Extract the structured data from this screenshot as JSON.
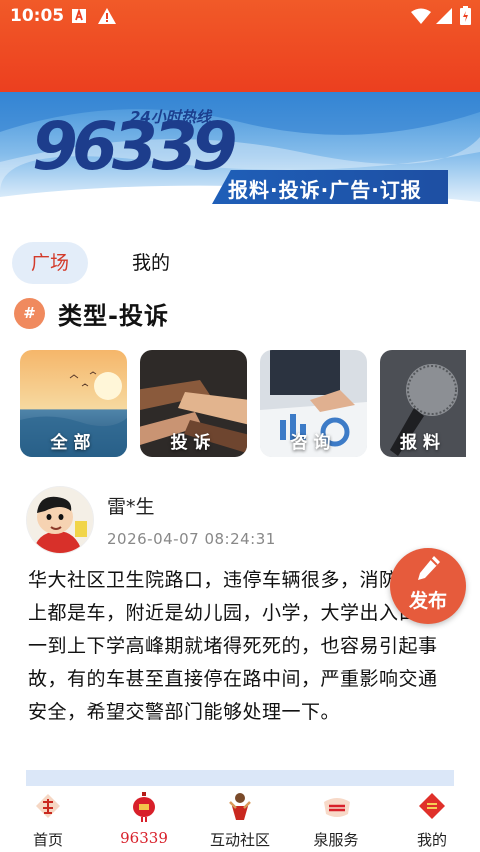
{
  "status_bar": {
    "time": "10:05",
    "icons": [
      "font-download-icon",
      "warning-icon",
      "wifi-icon",
      "signal-icon",
      "battery-icon"
    ]
  },
  "banner": {
    "hotline_label": "24小时热线",
    "number": "96339",
    "slogan": "报料·投诉·广告·订报"
  },
  "tabs": [
    {
      "label": "广场",
      "active": true
    },
    {
      "label": "我的",
      "active": false
    }
  ],
  "section": {
    "badge": "#",
    "title": "类型-投诉"
  },
  "categories": [
    {
      "label": "全部"
    },
    {
      "label": "投诉"
    },
    {
      "label": "咨询"
    },
    {
      "label": "报料"
    }
  ],
  "post": {
    "username": "雷*生",
    "time": "2026-04-07 08:24:31",
    "content": "华大社区卫生院路口，违停车辆很多，消防通道上都是车，附近是幼儿园，小学，大学出入口，一到上下学高峰期就堵得死死的，也容易引起事故，有的车甚至直接停在路中间，严重影响交通安全，希望交警部门能够处理一下。"
  },
  "fab": {
    "label": "发布"
  },
  "bottom_nav": [
    {
      "label": "首页",
      "active": false
    },
    {
      "label": "96339",
      "active": true
    },
    {
      "label": "互动社区",
      "active": false
    },
    {
      "label": "泉服务",
      "active": false
    },
    {
      "label": "我的",
      "active": false
    }
  ],
  "colors": {
    "header": "#ec3f1f",
    "accent_red": "#d8202a",
    "tab_active_bg": "#e3edf9",
    "fab": "#e65b3c"
  }
}
